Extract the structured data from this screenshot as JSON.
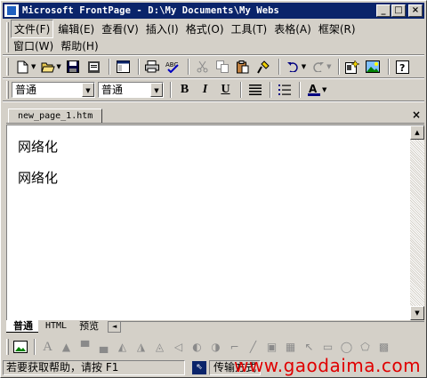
{
  "window": {
    "title": "Microsoft FrontPage - D:\\My Documents\\My Webs",
    "minimize": "_",
    "maximize": "□",
    "close": "×"
  },
  "menu": {
    "row1": [
      "文件(F)",
      "编辑(E)",
      "查看(V)",
      "插入(I)",
      "格式(O)",
      "工具(T)",
      "表格(A)",
      "框架(R)"
    ],
    "row2": [
      "窗口(W)",
      "帮助(H)"
    ]
  },
  "format_toolbar": {
    "style_value": "普通",
    "font_value": "普通",
    "bold": "B",
    "italic": "I",
    "underline": "U"
  },
  "document": {
    "tab_label": "new_page_1.htm",
    "close": "×",
    "lines": [
      "网络化",
      "网络化"
    ]
  },
  "view_tabs": [
    "普通",
    "HTML",
    "预览"
  ],
  "status": {
    "message": "若要获取帮助，请按 F1",
    "time_fragment": "传输方式",
    "watermark": "www.gaodaima.com"
  },
  "icons": [
    "app-icon",
    "new-page-icon",
    "open-icon",
    "save-icon",
    "publish-icon",
    "folder-list-icon",
    "print-icon",
    "spelling-icon",
    "cut-icon",
    "copy-icon",
    "paste-icon",
    "format-painter-icon",
    "undo-icon",
    "redo-icon",
    "insert-component-icon",
    "image-icon",
    "help-icon",
    "bold-icon",
    "italic-icon",
    "underline-icon",
    "align-icon",
    "bullets-icon",
    "font-color-icon"
  ]
}
